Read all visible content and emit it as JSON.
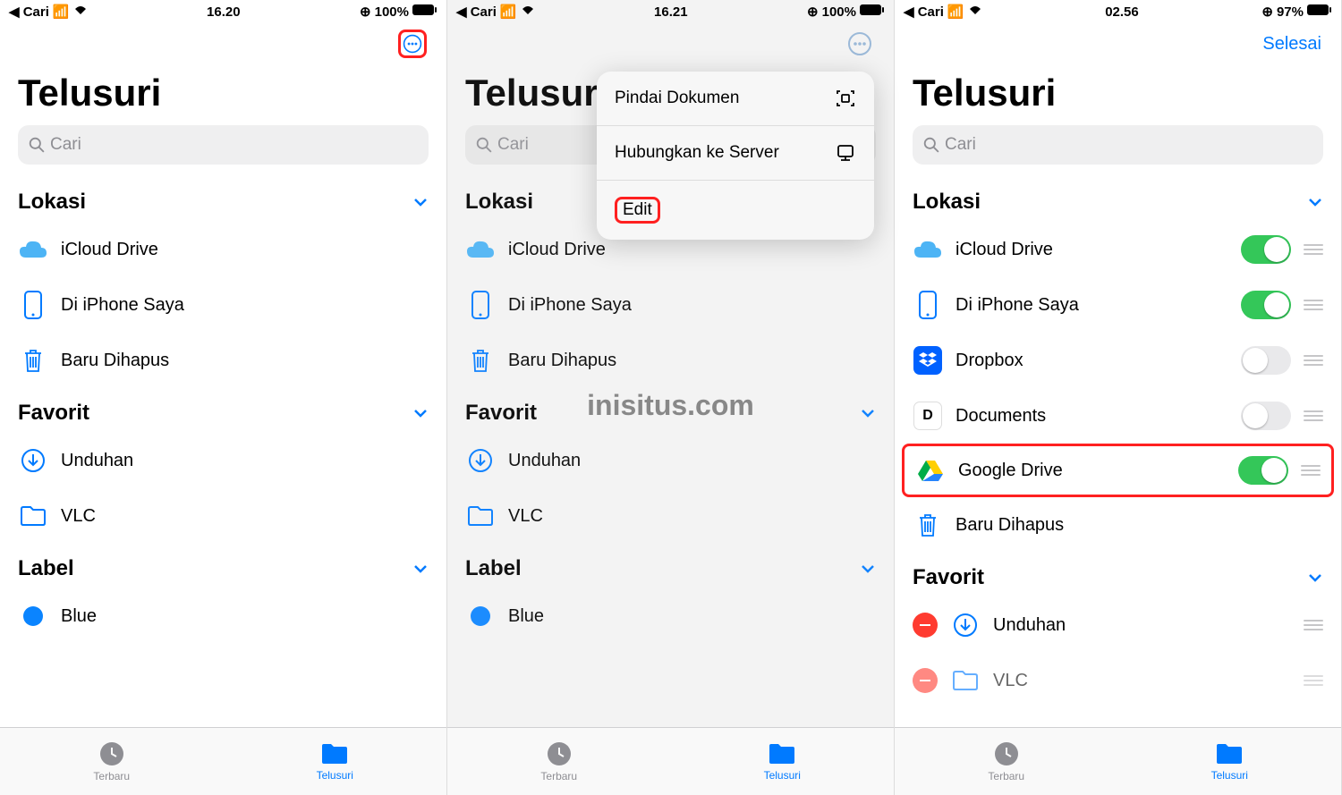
{
  "watermark": "inisitus.com",
  "screens": [
    {
      "status": {
        "back": "Cari",
        "time": "16.20",
        "battery": "100%"
      },
      "title": "Telusuri",
      "search_placeholder": "Cari",
      "done_label": null,
      "more_highlighted": true,
      "popover": null,
      "sections": {
        "lokasi": {
          "header": "Lokasi",
          "items": [
            {
              "icon": "icloud",
              "label": "iCloud Drive"
            },
            {
              "icon": "iphone",
              "label": "Di iPhone Saya"
            },
            {
              "icon": "trash",
              "label": "Baru Dihapus"
            }
          ]
        },
        "favorit": {
          "header": "Favorit",
          "items": [
            {
              "icon": "download",
              "label": "Unduhan"
            },
            {
              "icon": "folder",
              "label": "VLC"
            }
          ]
        },
        "label": {
          "header": "Label",
          "items": [
            {
              "icon": "dot",
              "label": "Blue"
            }
          ]
        }
      },
      "tabs": {
        "recent": "Terbaru",
        "browse": "Telusuri",
        "active": "browse"
      }
    },
    {
      "status": {
        "back": "Cari",
        "time": "16.21",
        "battery": "100%"
      },
      "title": "Telusuri",
      "search_placeholder": "Cari",
      "done_label": null,
      "more_highlighted": false,
      "popover": {
        "items": [
          {
            "label": "Pindai Dokumen",
            "icon": "scan"
          },
          {
            "label": "Hubungkan ke Server",
            "icon": "server"
          },
          {
            "label": "Edit",
            "icon": null,
            "highlight": true
          }
        ]
      },
      "sections": {
        "lokasi": {
          "header": "Lokasi",
          "items": [
            {
              "icon": "icloud",
              "label": "iCloud Drive"
            },
            {
              "icon": "iphone",
              "label": "Di iPhone Saya"
            },
            {
              "icon": "trash",
              "label": "Baru Dihapus"
            }
          ]
        },
        "favorit": {
          "header": "Favorit",
          "items": [
            {
              "icon": "download",
              "label": "Unduhan"
            },
            {
              "icon": "folder",
              "label": "VLC"
            }
          ]
        },
        "label": {
          "header": "Label",
          "items": [
            {
              "icon": "dot",
              "label": "Blue"
            }
          ]
        }
      },
      "tabs": {
        "recent": "Terbaru",
        "browse": "Telusuri",
        "active": "browse"
      }
    },
    {
      "status": {
        "back": "Cari",
        "time": "02.56",
        "battery": "97%"
      },
      "title": "Telusuri",
      "search_placeholder": "Cari",
      "done_label": "Selesai",
      "more_highlighted": false,
      "popover": null,
      "edit_mode": true,
      "sections": {
        "lokasi": {
          "header": "Lokasi",
          "items": [
            {
              "icon": "icloud",
              "label": "iCloud Drive",
              "toggle": true
            },
            {
              "icon": "iphone",
              "label": "Di iPhone Saya",
              "toggle": true
            },
            {
              "icon": "dropbox",
              "label": "Dropbox",
              "toggle": false
            },
            {
              "icon": "documents",
              "label": "Documents",
              "toggle": false
            },
            {
              "icon": "gdrive",
              "label": "Google Drive",
              "toggle": true,
              "highlight": true
            },
            {
              "icon": "trash",
              "label": "Baru Dihapus"
            }
          ]
        },
        "favorit": {
          "header": "Favorit",
          "items": [
            {
              "icon": "download",
              "label": "Unduhan",
              "removable": true
            },
            {
              "icon": "folder",
              "label": "VLC",
              "removable": true
            }
          ]
        }
      },
      "tabs": {
        "recent": "Terbaru",
        "browse": "Telusuri",
        "active": "browse"
      }
    }
  ]
}
